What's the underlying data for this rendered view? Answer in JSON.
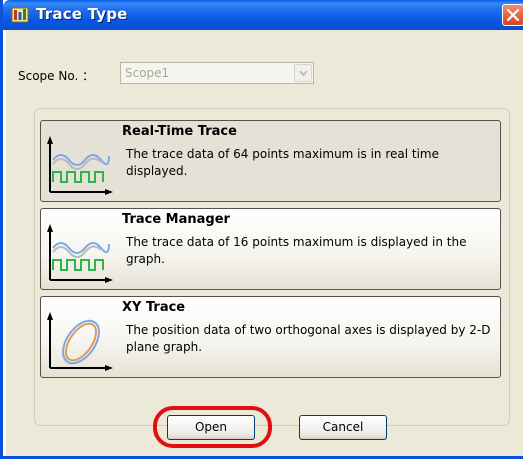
{
  "window": {
    "title": "Trace Type"
  },
  "scope": {
    "label": "Scope No. ：",
    "value": "Scope1"
  },
  "options": [
    {
      "title": "Real-Time Trace",
      "description": "The trace data of 64 points maximum is in real time displayed.",
      "icon": "waveform-trace-icon",
      "selected": true
    },
    {
      "title": "Trace Manager",
      "description": "The trace data of 16 points maximum is displayed in the graph.",
      "icon": "waveform-trace-icon",
      "selected": false
    },
    {
      "title": "XY Trace",
      "description": "The position data of two orthogonal axes is displayed by 2-D plane graph.",
      "icon": "xy-ellipse-icon",
      "selected": false
    }
  ],
  "buttons": {
    "open": "Open",
    "cancel": "Cancel"
  },
  "colors": {
    "titlebar": "#0a5ee8",
    "highlight_ring": "#e01010",
    "dialog_bg": "#ece9d8"
  }
}
